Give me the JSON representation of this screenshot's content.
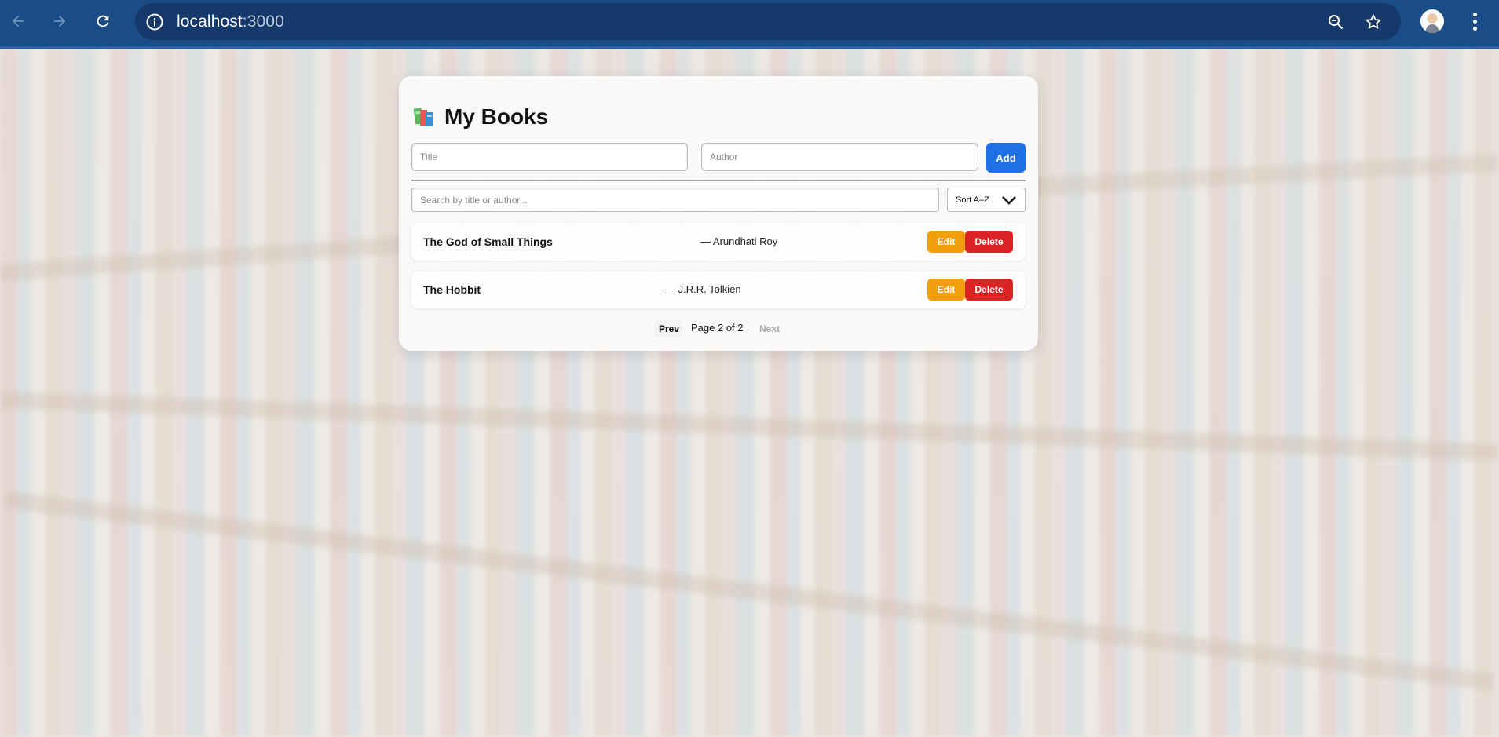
{
  "browser": {
    "url_host": "localhost",
    "url_port": ":3000",
    "icons": [
      "back-arrow-icon",
      "forward-arrow-icon",
      "reload-icon",
      "site-info-icon",
      "zoom-icon",
      "bookmark-star-icon",
      "profile-avatar",
      "more-menu-icon"
    ]
  },
  "app": {
    "title": "My Books",
    "title_icon": "books-icon",
    "form": {
      "title_placeholder": "Title",
      "author_placeholder": "Author",
      "add_label": "Add"
    },
    "search_placeholder": "Search by title or author...",
    "sort": {
      "selected": "Sort A–Z",
      "icon": "chevron-down-icon"
    },
    "books": [
      {
        "title": "The God of Small Things",
        "author": "— Arundhati Roy",
        "edit_label": "Edit",
        "delete_label": "Delete"
      },
      {
        "title": "The Hobbit",
        "author": "— J.R.R. Tolkien",
        "edit_label": "Edit",
        "delete_label": "Delete"
      }
    ],
    "pagination": {
      "prev_label": "Prev",
      "page_text": "Page 2 of 2",
      "next_label": "Next",
      "current_page": 2,
      "total_pages": 2
    }
  },
  "colors": {
    "browser_bar": "#1a4c86",
    "add_button": "#1f6fe5",
    "edit_button": "#f29f0d",
    "delete_button": "#dc2426"
  }
}
